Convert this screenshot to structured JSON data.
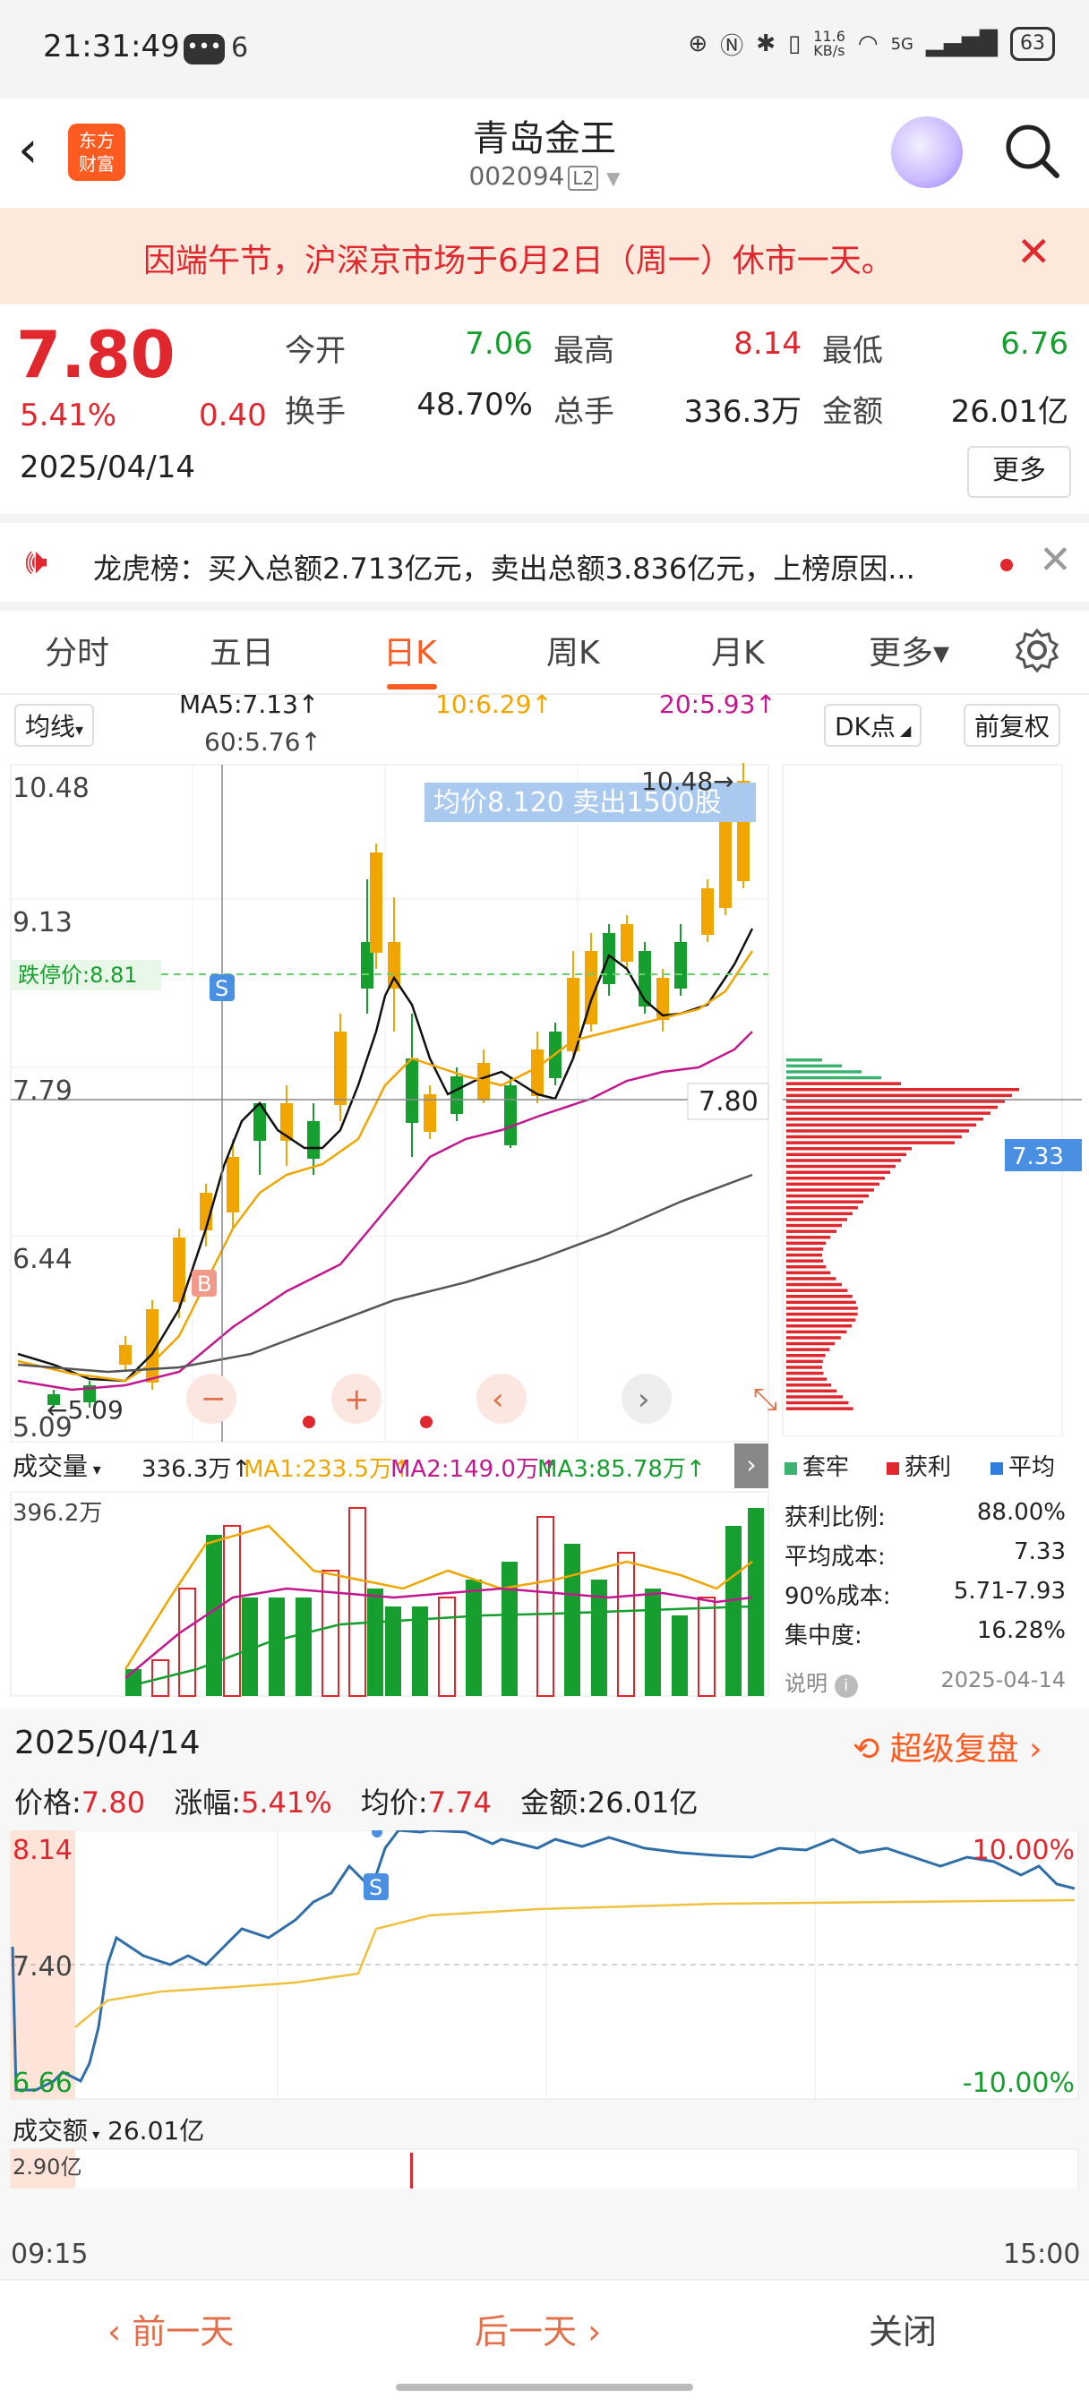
{
  "status_bar": {
    "time": "21:31:49",
    "chat_badge": "•••",
    "notif_count": "6",
    "speed": "11.6\nKB/s",
    "battery": "63",
    "net": "5G"
  },
  "header": {
    "logo_text": "东方\n财富",
    "title": "青岛金王",
    "code": "002094",
    "level": "L2"
  },
  "notice": {
    "text": "因端午节，沪深京市场于6月2日（周一）休市一天。"
  },
  "quote": {
    "price": "7.80",
    "pct": "5.41%",
    "change": "0.40",
    "date": "2025/04/14",
    "fields": [
      {
        "label": "今开",
        "value": "7.06",
        "color": "green"
      },
      {
        "label": "最高",
        "value": "8.14",
        "color": "red"
      },
      {
        "label": "最低",
        "value": "6.76",
        "color": "green"
      },
      {
        "label": "换手",
        "value": "48.70%",
        "color": "dark"
      },
      {
        "label": "总手",
        "value": "336.3万",
        "color": "dark"
      },
      {
        "label": "金额",
        "value": "26.01亿",
        "color": "dark"
      }
    ],
    "more_label": "更多"
  },
  "dragon": {
    "text": "龙虎榜：买入总额2.713亿元，卖出总额3.836亿元，上榜原因..."
  },
  "tabs": [
    "分时",
    "五日",
    "日K",
    "周K",
    "月K",
    "更多▾"
  ],
  "active_tab": 2,
  "kline": {
    "indicator_select": "均线",
    "ma5": "MA5:7.13↑",
    "ma10": "10:6.29↑",
    "ma20": "20:5.93↑",
    "ma60": "60:5.76↑",
    "dk_label": "DK点",
    "adjust_label": "前复权",
    "y_labels": [
      "10.48",
      "9.13",
      "7.79",
      "6.44",
      "5.09"
    ],
    "high_label": "10.48→",
    "low_label": "←5.09",
    "limit_down_label": "跌停价:8.81",
    "tooltip": "均价8.120  卖出1500股",
    "crosshair_price": "7.80",
    "chip_price": "7.33",
    "marker_s": "S",
    "marker_b": "B"
  },
  "volume": {
    "select": "成交量",
    "total": "336.3万↑",
    "ma1": "MA1:233.5万↑",
    "ma2": "MA2:149.0万↑",
    "ma3": "MA3:85.78万↑",
    "max_label": "396.2万"
  },
  "chips": {
    "legend": [
      {
        "label": "套牢",
        "color": "#3cb371"
      },
      {
        "label": "获利",
        "color": "#e0272e"
      },
      {
        "label": "平均",
        "color": "#2f7fe0"
      }
    ],
    "rows": [
      {
        "label": "获利比例:",
        "value": "88.00%"
      },
      {
        "label": "平均成本:",
        "value": "7.33"
      },
      {
        "label": "90%成本:",
        "value": "5.71-7.93"
      },
      {
        "label": "集中度:",
        "value": "16.28%"
      }
    ],
    "note_label": "说明",
    "note_date": "2025-04-14"
  },
  "intraday": {
    "date": "2025/04/14",
    "replay_label": "超级复盘",
    "price_label": "价格:",
    "price": "7.80",
    "chg_label": "涨幅:",
    "chg": "5.41%",
    "avg_label": "均价:",
    "avg": "7.74",
    "amt_label": "金额:",
    "amt": "26.01亿",
    "y_top": "8.14",
    "y_mid": "7.40",
    "y_bot": "6.66",
    "pct_top": "10.00%",
    "pct_bot": "-10.00%",
    "vol_select": "成交额",
    "vol_total": "26.01亿",
    "vol_max": "2.90亿",
    "time_start": "09:15",
    "time_end": "15:00",
    "marker_s": "S"
  },
  "nav": {
    "prev": "前一天",
    "next": "后一天",
    "close": "关闭"
  }
}
